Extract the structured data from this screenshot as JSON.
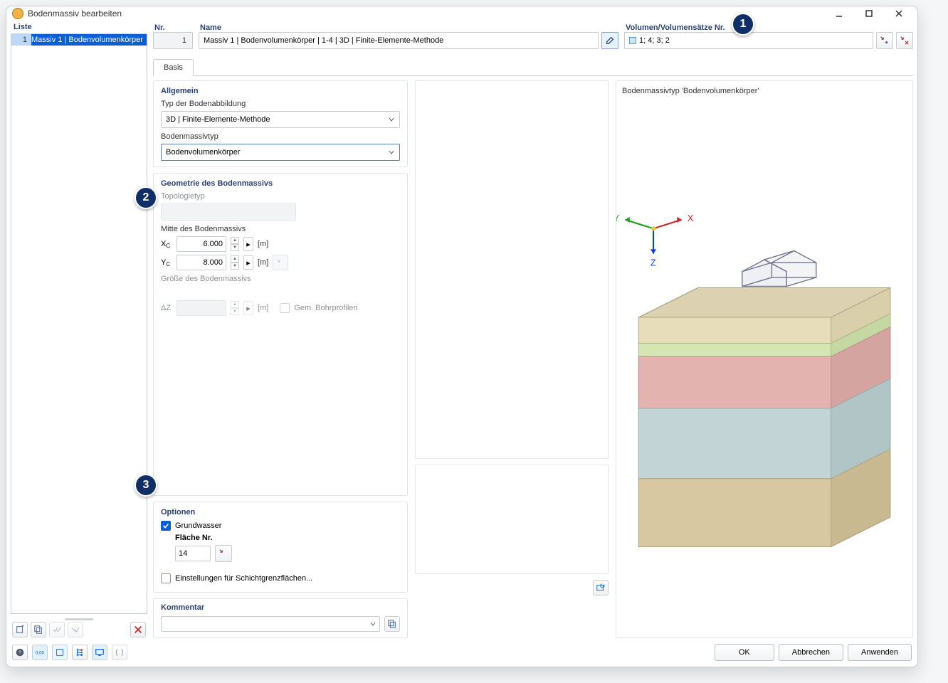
{
  "window": {
    "title": "Bodenmassiv bearbeiten"
  },
  "list": {
    "header": "Liste",
    "items": [
      {
        "num": "1",
        "label": "Massiv 1 | Bodenvolumenkörper"
      }
    ]
  },
  "nr": {
    "label": "Nr.",
    "value": "1"
  },
  "name": {
    "label": "Name",
    "value": "Massiv 1 | Bodenvolumenkörper | 1-4 | 3D | Finite-Elemente-Methode"
  },
  "volumes": {
    "label": "Volumen/Volumensätze Nr.",
    "value": "1; 4; 3; 2"
  },
  "tabs": [
    "Basis"
  ],
  "general": {
    "title": "Allgemein",
    "type_label": "Typ der Bodenabbildung",
    "type_value": "3D | Finite-Elemente-Methode",
    "massif_label": "Bodenmassivtyp",
    "massif_value": "Bodenvolumenkörper"
  },
  "geometry": {
    "title": "Geometrie des Bodenmassivs",
    "topo_label": "Topologietyp",
    "center_label": "Mitte des Bodenmassivs",
    "xc_label": "X",
    "xc_sub": "C",
    "xc_value": "6.000",
    "yc_label": "Y",
    "yc_sub": "C",
    "yc_value": "8.000",
    "unit_m": "[m]",
    "size_label": "Größe des Bodenmassivs",
    "dz_label": "ΔZ",
    "drill_label": "Gem. Bohrprofilen"
  },
  "options": {
    "title": "Optionen",
    "gw_label": "Grundwasser",
    "surface_label": "Fläche Nr.",
    "surface_value": "14",
    "settings_label": "Einstellungen für Schichtgrenzflächen..."
  },
  "comment": {
    "title": "Kommentar"
  },
  "right": {
    "title": "Bodenmassivtyp 'Bodenvolumenkörper'"
  },
  "axes": {
    "x": "X",
    "y": "Y",
    "z": "Z"
  },
  "buttons": {
    "ok": "OK",
    "cancel": "Abbrechen",
    "apply": "Anwenden"
  },
  "badges": {
    "b1": "1",
    "b2": "2",
    "b3": "3"
  }
}
